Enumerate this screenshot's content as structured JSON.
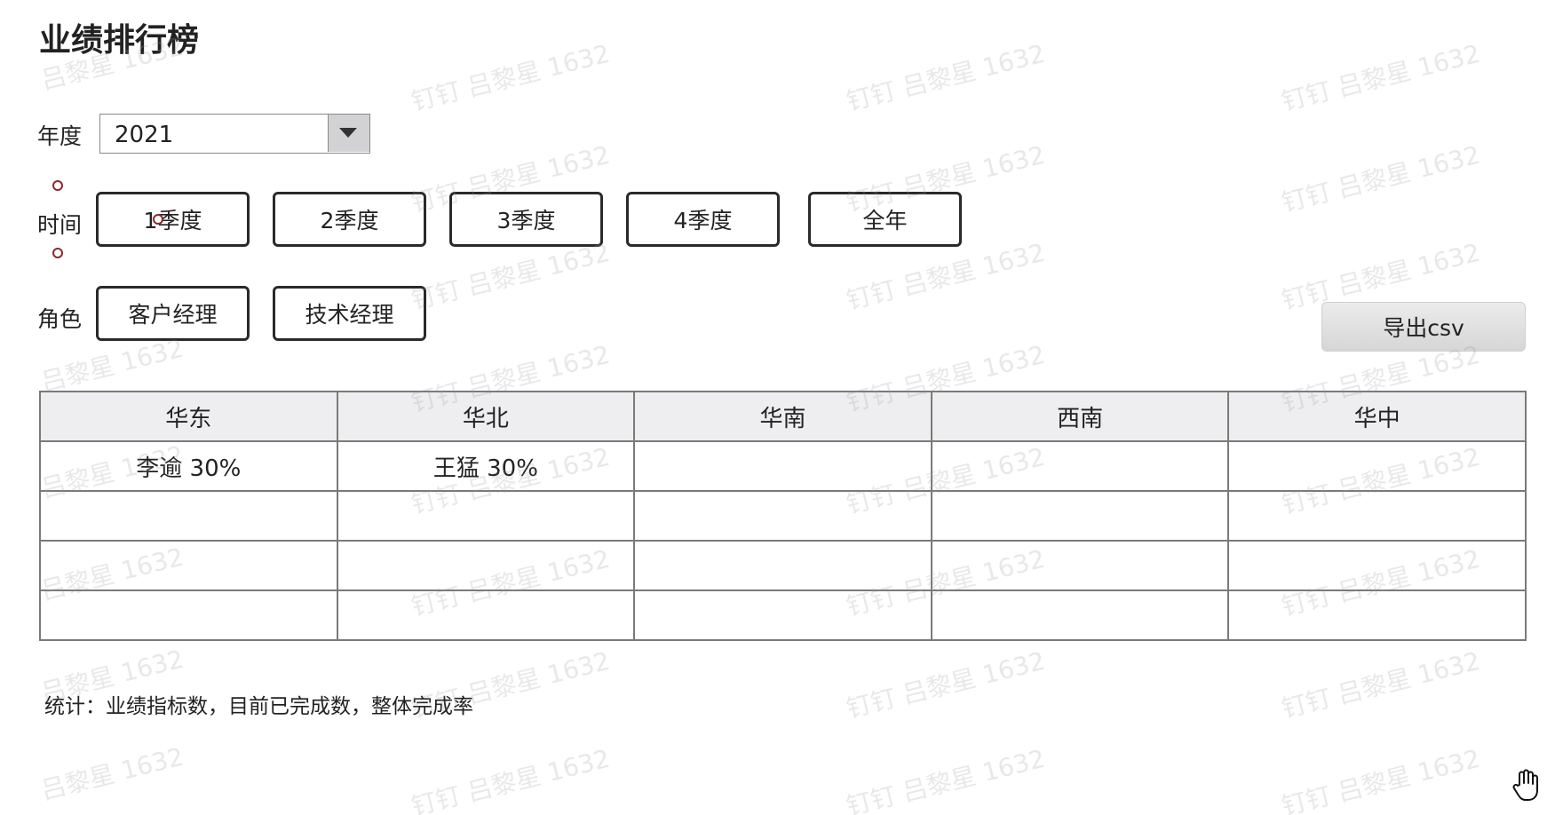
{
  "title": "业绩排行榜",
  "filters": {
    "year": {
      "label": "年度",
      "value": "2021"
    },
    "time": {
      "label": "时间",
      "options": [
        "1季度",
        "2季度",
        "3季度",
        "4季度",
        "全年"
      ]
    },
    "role": {
      "label": "角色",
      "options": [
        "客户经理",
        "技术经理"
      ]
    }
  },
  "export_label": "导出csv",
  "table": {
    "headers": [
      "华东",
      "华北",
      "华南",
      "西南",
      "华中"
    ],
    "rows": [
      [
        "李逾 30%",
        "王猛 30%",
        "",
        "",
        ""
      ],
      [
        "",
        "",
        "",
        "",
        ""
      ],
      [
        "",
        "",
        "",
        "",
        ""
      ],
      [
        "",
        "",
        "",
        "",
        ""
      ]
    ]
  },
  "footer": "统计：业绩指标数，目前已完成数，整体完成率",
  "watermark": "吕黎星 1632",
  "watermark_prefix": "钉钉",
  "colors": {
    "header_bg": "#eeeef0",
    "border": "#7a7a7a",
    "radio_accent": "#8b2a2a",
    "export_bg": "#dddddd"
  }
}
